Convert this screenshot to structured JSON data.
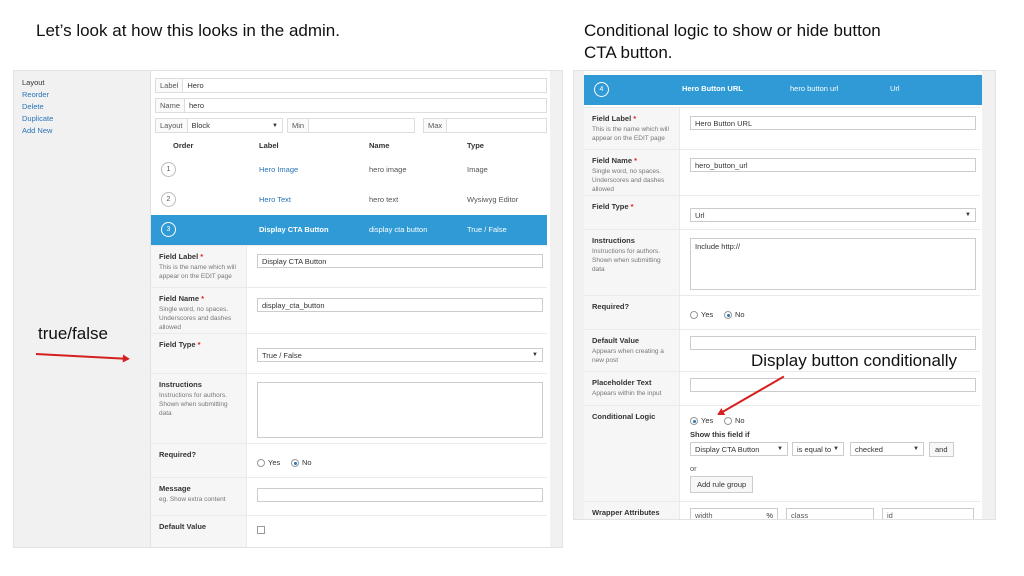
{
  "captions": {
    "left": "Let’s look at how this looks in the admin.",
    "right_line1": "Conditional logic to show or hide button",
    "right_line2": "CTA button.",
    "truefalse": "true/false",
    "display_conditional": "Display button conditionally"
  },
  "left": {
    "menu": [
      "Layout",
      "Reorder",
      "Delete",
      "Duplicate",
      "Add New"
    ],
    "label_label": "Label",
    "label_value": "Hero",
    "name_label": "Name",
    "name_value": "hero",
    "layout_label": "Layout",
    "layout_value": "Block",
    "min_label": "Min",
    "max_label": "Max",
    "columns": [
      "Order",
      "Label",
      "Name",
      "Type"
    ],
    "rows": [
      {
        "order": "1",
        "label": "Hero Image",
        "name": "hero image",
        "type": "Image"
      },
      {
        "order": "2",
        "label": "Hero Text",
        "name": "hero text",
        "type": "Wysiwyg Editor"
      },
      {
        "order": "3",
        "label": "Display CTA Button",
        "name": "display cta button",
        "type": "True / False"
      }
    ],
    "field_label": {
      "title": "Field Label",
      "desc": "This is the name which will appear on the EDIT page",
      "value": "Display CTA Button"
    },
    "field_name": {
      "title": "Field Name",
      "desc": "Single word, no spaces. Underscores and dashes allowed",
      "value": "display_cta_button"
    },
    "field_type": {
      "title": "Field Type",
      "value": "True / False"
    },
    "instructions": {
      "title": "Instructions",
      "desc": "Instructions for authors. Shown when submitting data"
    },
    "required": {
      "title": "Required?",
      "yes": "Yes",
      "no": "No"
    },
    "message": {
      "title": "Message",
      "desc": "eg. Show extra content"
    },
    "default_value": {
      "title": "Default Value"
    }
  },
  "right": {
    "header": {
      "order": "4",
      "label": "Hero Button URL",
      "name": "hero button url",
      "type": "Url"
    },
    "field_label": {
      "title": "Field Label",
      "desc": "This is the name which will appear on the EDIT page",
      "value": "Hero Button URL"
    },
    "field_name": {
      "title": "Field Name",
      "desc": "Single word, no spaces. Underscores and dashes allowed",
      "value": "hero_button_url"
    },
    "field_type": {
      "title": "Field Type",
      "value": "Url"
    },
    "instructions": {
      "title": "Instructions",
      "desc": "Instructions for authors. Shown when submitting data",
      "value": "Include http://"
    },
    "required": {
      "title": "Required?",
      "yes": "Yes",
      "no": "No"
    },
    "default_value": {
      "title": "Default Value",
      "desc": "Appears when creating a new post"
    },
    "placeholder": {
      "title": "Placeholder Text",
      "desc": "Appears within the input"
    },
    "conditional": {
      "title": "Conditional Logic",
      "yes": "Yes",
      "no": "No",
      "show_if": "Show this field if",
      "field": "Display CTA Button",
      "operator": "is equal to",
      "value": "checked",
      "and": "and",
      "or": "or",
      "add_group": "Add rule group"
    },
    "wrapper": {
      "title": "Wrapper Attributes",
      "width": "width",
      "pct": "%",
      "class": "class",
      "id": "id"
    }
  },
  "colors": {
    "accent": "#2f9ad6",
    "arrow": "#d62020",
    "link": "#2a74b8"
  }
}
